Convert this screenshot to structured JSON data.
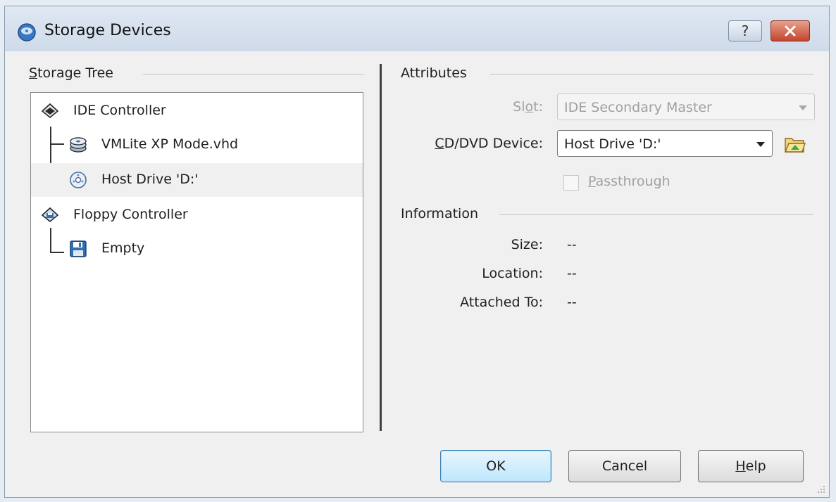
{
  "window": {
    "title": "Storage Devices",
    "help_button": "?",
    "close_icon": "close-icon"
  },
  "storage_tree": {
    "label": "Storage Tree",
    "items": [
      {
        "label": "IDE Controller",
        "icon": "ide-controller-icon",
        "level": 0
      },
      {
        "label": "VMLite XP Mode.vhd",
        "icon": "hard-disk-icon",
        "level": 1
      },
      {
        "label": "Host Drive 'D:'",
        "icon": "cd-dvd-icon",
        "level": 1,
        "selected": true
      },
      {
        "label": "Floppy Controller",
        "icon": "floppy-controller-icon",
        "level": 0
      },
      {
        "label": "Empty",
        "icon": "floppy-disk-icon",
        "level": 1
      }
    ]
  },
  "attributes": {
    "label": "Attributes",
    "slot_label": "Slot:",
    "slot_value": "IDE Secondary Master",
    "device_label": "CD/DVD Device:",
    "device_value": "Host Drive 'D:'",
    "passthrough_label": "Passthrough",
    "passthrough_checked": false
  },
  "information": {
    "label": "Information",
    "size_label": "Size:",
    "size_value": "--",
    "location_label": "Location:",
    "location_value": "--",
    "attached_label": "Attached To:",
    "attached_value": "--"
  },
  "buttons": {
    "ok": "OK",
    "cancel": "Cancel",
    "help": "Help"
  },
  "colors": {
    "selection": "#f0f0f0",
    "default_button": "#bee6fd",
    "close_button": "#c2452e"
  }
}
